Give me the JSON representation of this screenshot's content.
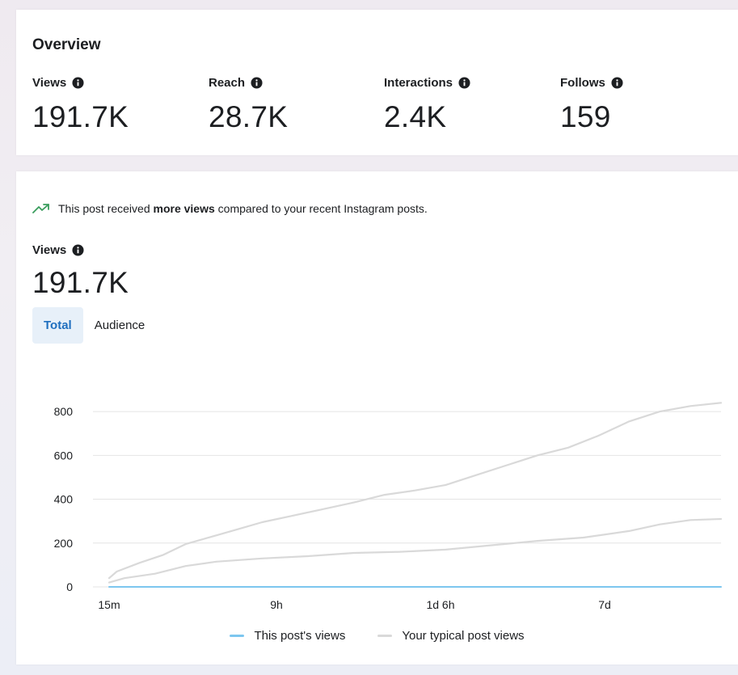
{
  "overview": {
    "title": "Overview",
    "metrics": [
      {
        "label": "Views",
        "value": "191.7K"
      },
      {
        "label": "Reach",
        "value": "28.7K"
      },
      {
        "label": "Interactions",
        "value": "2.4K"
      },
      {
        "label": "Follows",
        "value": "159"
      }
    ]
  },
  "views_card": {
    "insight_prefix": "This post received ",
    "insight_bold": "more views",
    "insight_suffix": " compared to your recent Instagram posts.",
    "views_label": "Views",
    "views_value": "191.7K",
    "tabs": [
      {
        "label": "Total",
        "active": true
      },
      {
        "label": "Audience",
        "active": false
      }
    ],
    "legend": [
      {
        "label": "This post's views",
        "color": "#7cc6ef"
      },
      {
        "label": "Your typical post views",
        "color": "#d9d9d9"
      }
    ]
  },
  "colors": {
    "accent": "#1f6fbf",
    "trend": "#3a9d5d",
    "this_post": "#7cc6ef",
    "typical": "#d9d9d9",
    "grid": "#e4e4e4"
  },
  "chart_data": {
    "type": "line",
    "x_tick_labels": [
      "15m",
      "9h",
      "1d 6h",
      "7d"
    ],
    "y_ticks": [
      0,
      200,
      400,
      600,
      800
    ],
    "ylim": [
      0,
      900
    ],
    "grid": true,
    "legend_position": "bottom",
    "series": [
      {
        "name": "This post's views",
        "x": [
          0,
          1,
          2,
          3,
          4
        ],
        "values": [
          0,
          0,
          0,
          0,
          0
        ]
      },
      {
        "name": "Your typical post views",
        "x": [
          0,
          0.05,
          0.2,
          0.35,
          0.5,
          0.7,
          0.85,
          1.0,
          1.2,
          1.4,
          1.6,
          1.8,
          2.0,
          2.2,
          2.4,
          2.6,
          2.8,
          3.0,
          3.2,
          3.4,
          3.6,
          3.8,
          4.0
        ],
        "values": [
          40,
          70,
          110,
          145,
          195,
          235,
          265,
          295,
          325,
          355,
          385,
          420,
          440,
          465,
          510,
          555,
          600,
          635,
          690,
          755,
          800,
          825,
          840
        ]
      },
      {
        "name": "Your typical post views",
        "x": [
          0,
          0.1,
          0.3,
          0.5,
          0.7,
          1.0,
          1.3,
          1.6,
          1.9,
          2.2,
          2.5,
          2.8,
          3.1,
          3.4,
          3.6,
          3.8,
          4.0
        ],
        "values": [
          20,
          40,
          60,
          95,
          115,
          130,
          140,
          155,
          160,
          170,
          190,
          210,
          225,
          255,
          285,
          305,
          310
        ]
      }
    ]
  }
}
